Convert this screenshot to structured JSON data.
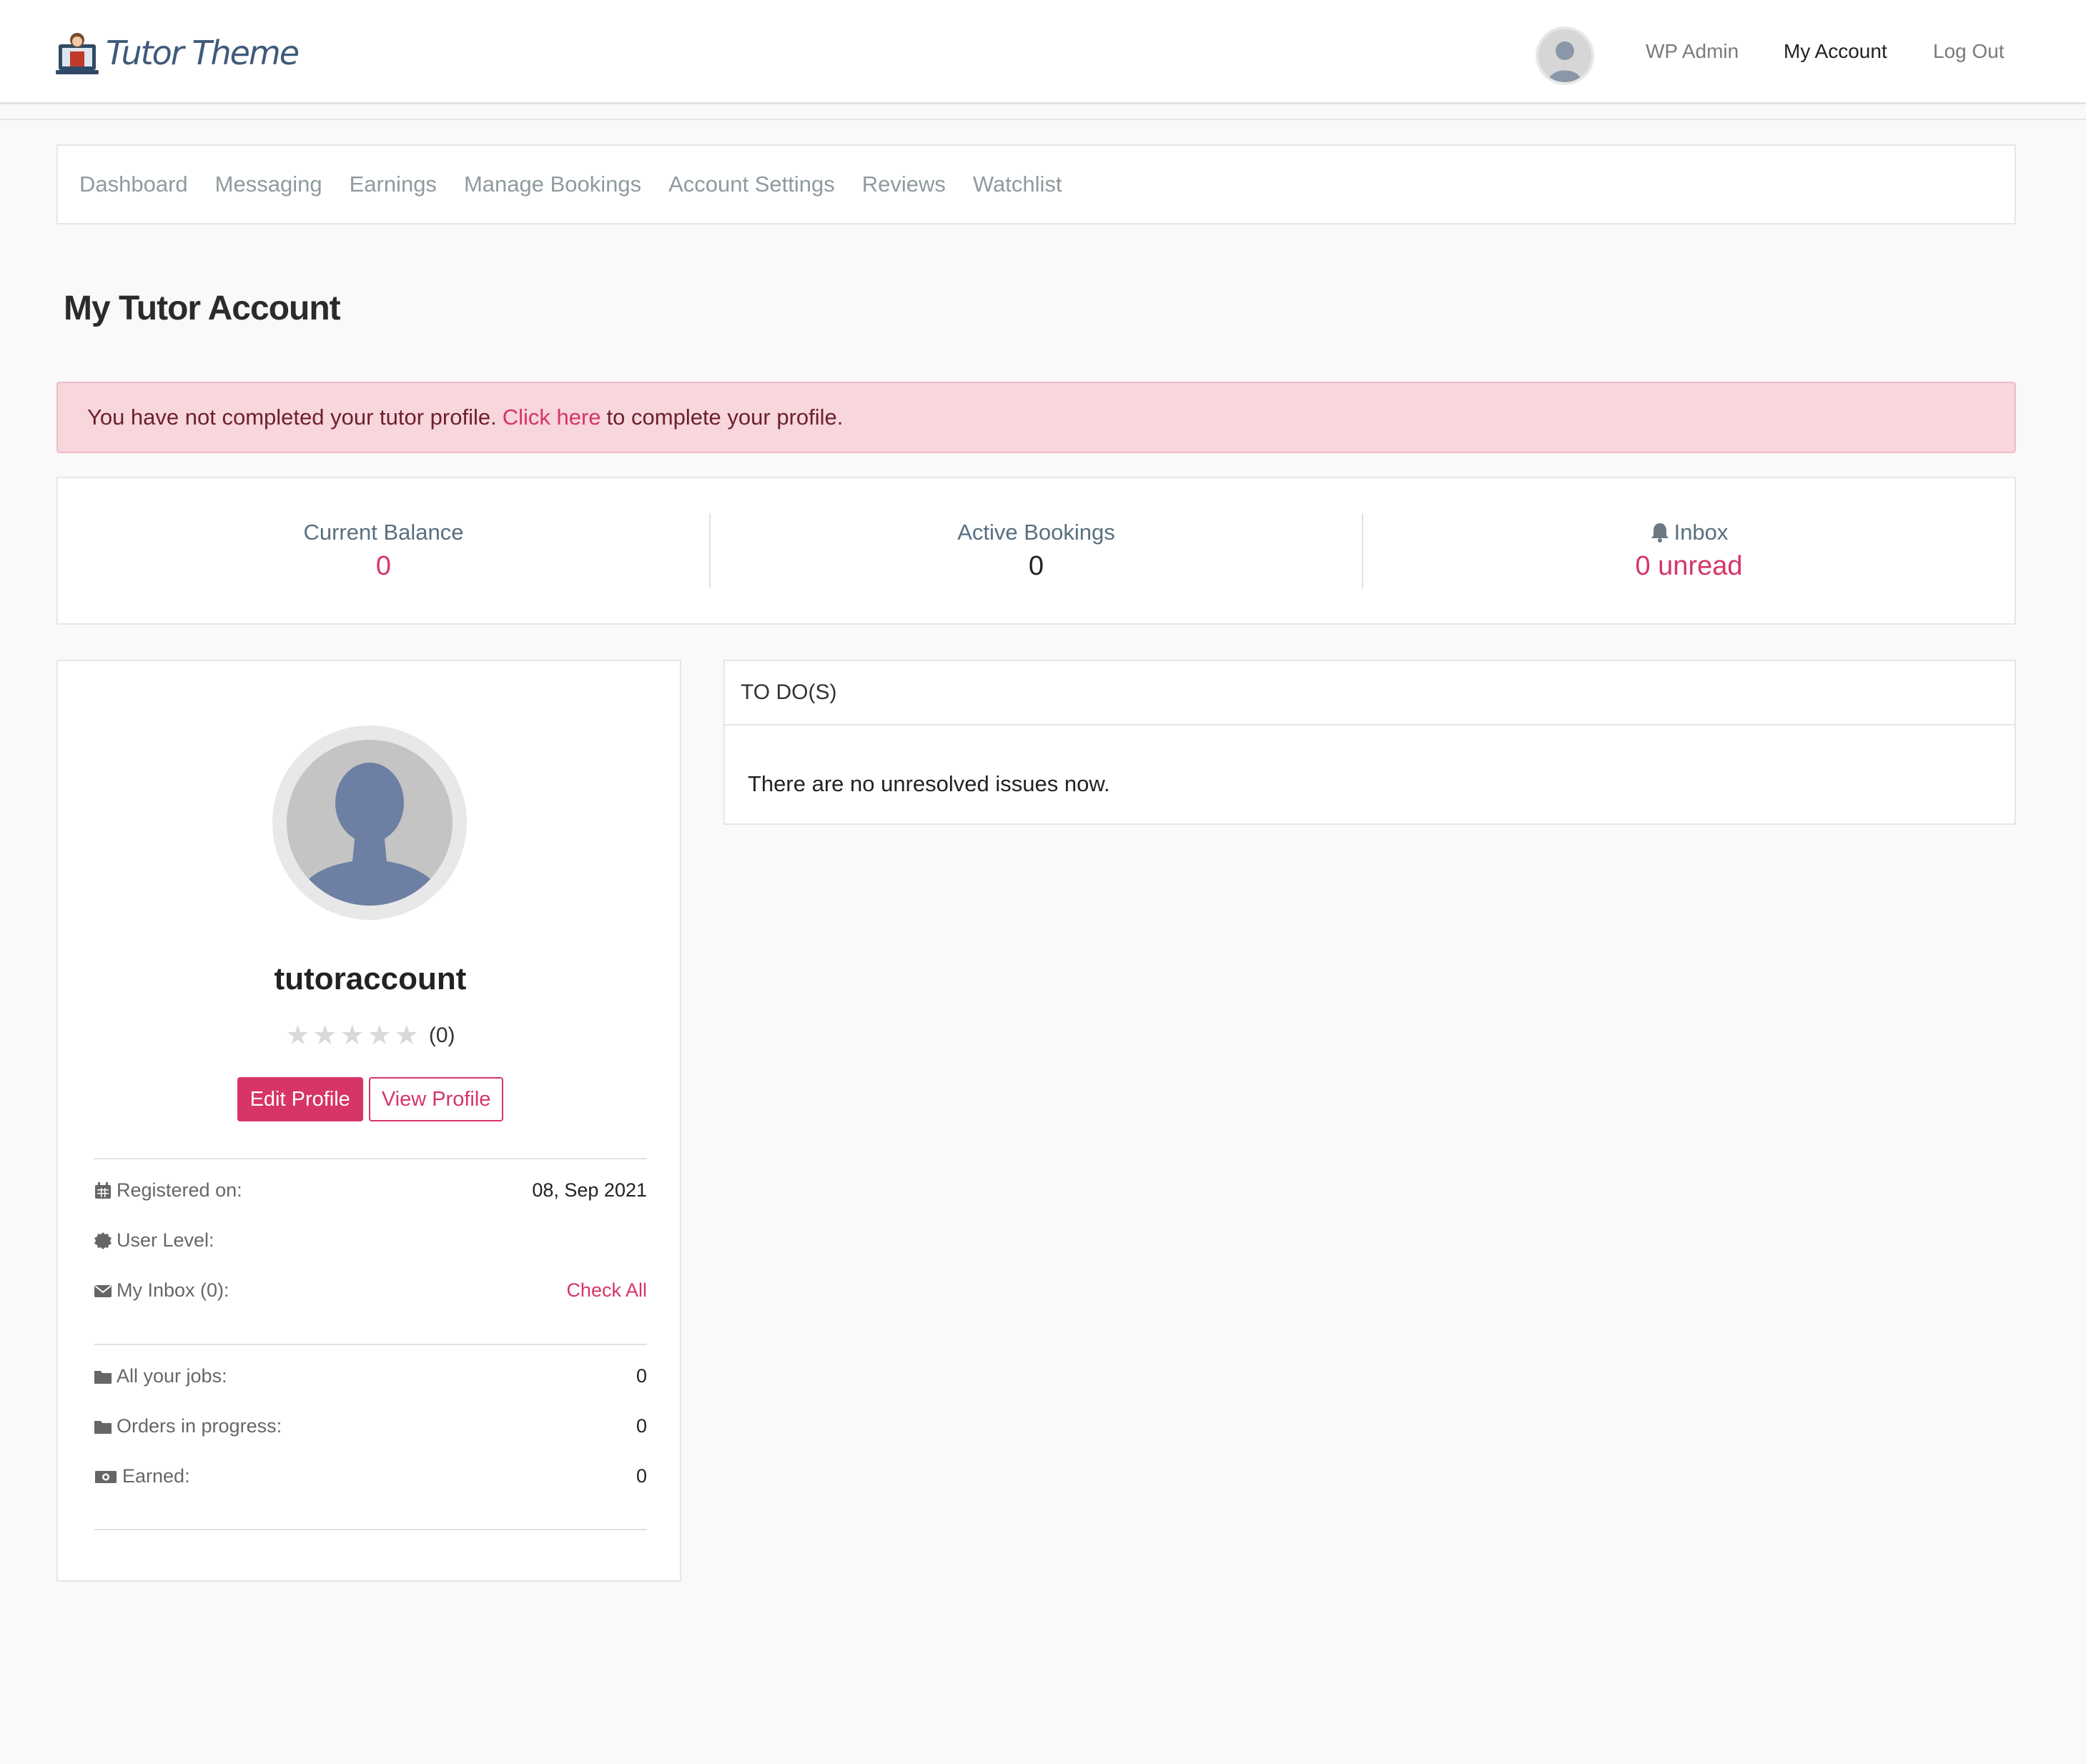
{
  "header": {
    "logo_text": "Tutor Theme",
    "nav": [
      {
        "label": "WP Admin"
      },
      {
        "label": "My Account"
      },
      {
        "label": "Log Out"
      }
    ]
  },
  "tabs": [
    {
      "label": "Dashboard"
    },
    {
      "label": "Messaging"
    },
    {
      "label": "Earnings"
    },
    {
      "label": "Manage Bookings"
    },
    {
      "label": "Account Settings"
    },
    {
      "label": "Reviews"
    },
    {
      "label": "Watchlist"
    }
  ],
  "page_title": "My Tutor Account",
  "alert": {
    "text_before": "You have not completed your tutor profile.",
    "link": "Click here",
    "text_after": "to complete your profile."
  },
  "stats": {
    "balance": {
      "label": "Current Balance",
      "value": "0"
    },
    "bookings": {
      "label": "Active Bookings",
      "value": "0"
    },
    "inbox": {
      "label": "Inbox",
      "value": "0 unread",
      "icon": "bell-icon"
    }
  },
  "profile": {
    "username": "tutoraccount",
    "rating_count": "(0)",
    "rating": 0,
    "edit_label": "Edit Profile",
    "view_label": "View Profile",
    "registered_label": "Registered on:",
    "registered_value": "08, Sep 2021",
    "level_label": "User Level:",
    "inbox_label": "My Inbox (0):",
    "inbox_link": "Check All",
    "jobs_label": "All your jobs:",
    "jobs_value": "0",
    "orders_label": "Orders in progress:",
    "orders_value": "0",
    "earned_label": "Earned:",
    "earned_value": "0"
  },
  "todo": {
    "title": "TO DO(S)",
    "message": "There are no unresolved issues now."
  },
  "colors": {
    "accent": "#d63566",
    "alert_bg": "#f7d6dc",
    "tab_text": "#8f9a9f"
  }
}
